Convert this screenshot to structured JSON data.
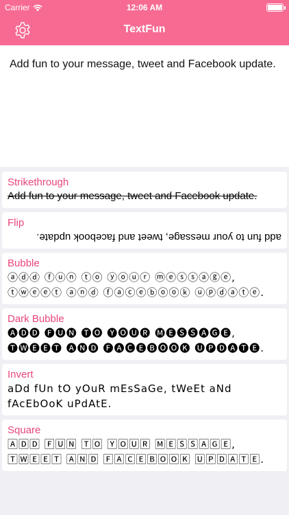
{
  "status": {
    "carrier": "Carrier",
    "time": "12:06 AM"
  },
  "navbar": {
    "title": "TextFun",
    "settings_icon": "gear-icon"
  },
  "composer": {
    "text": "Add fun to your message, tweet and Facebook update."
  },
  "styles": [
    {
      "label": "Strikethrough",
      "text": "Add fun to your message, tweet and Facebook update."
    },
    {
      "label": "Flip",
      "text": "add fun to your message, tweet and facebook update."
    },
    {
      "label": "Bubble",
      "text": "ⓐⓓⓓ ⓕⓤⓝ ⓣⓞ ⓨⓞⓤⓡ ⓜⓔⓢⓢⓐⓖⓔ, ⓣⓦⓔⓔⓣ ⓐⓝⓓ ⓕⓐⓒⓔⓑⓞⓞⓚ ⓤⓟⓓⓐⓣⓔ."
    },
    {
      "label": "Dark Bubble",
      "text": "🅐🅓🅓 🅕🅤🅝 🅣🅞 🅨🅞🅤🅡 🅜🅔🅢🅢🅐🅖🅔, 🅣🅦🅔🅔🅣 🅐🅝🅓 🅕🅐🅒🅔🅑🅞🅞🅚 🅤🅟🅓🅐🅣🅔."
    },
    {
      "label": "Invert",
      "text": "aDd fUn tO yOuR mEsSaGe, tWeEt aNd fAcEbOoK uPdAtE."
    },
    {
      "label": "Square",
      "text": "🄰🄳🄳 🄵🅄🄽 🅃🄾 🅈🄾🅄🅁 🄼🄴🅂🅂🄰🄶🄴, 🅃🅆🄴🄴🅃 🄰🄽🄳 🄵🄰🄲🄴🄱🄾🄾🄺 🅄🄿🄳🄰🅃🄴."
    }
  ]
}
